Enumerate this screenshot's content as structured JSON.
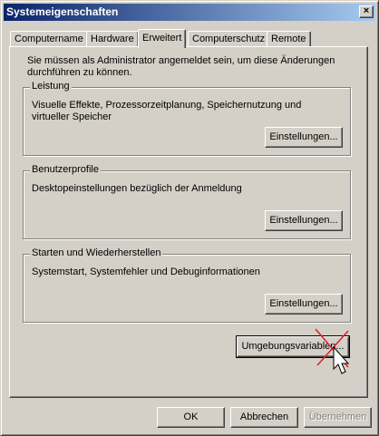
{
  "window": {
    "title": "Systemeigenschaften",
    "close_glyph": "×"
  },
  "tabs": [
    {
      "label": "Computername"
    },
    {
      "label": "Hardware"
    },
    {
      "label": "Erweitert"
    },
    {
      "label": "Computerschutz"
    },
    {
      "label": "Remote"
    }
  ],
  "active_tab": "Erweitert",
  "note": "Sie müssen als Administrator angemeldet sein, um diese Änderungen durchführen zu können.",
  "groups": {
    "performance": {
      "title": "Leistung",
      "text": "Visuelle Effekte, Prozessorzeitplanung, Speichernutzung und virtueller Speicher",
      "button": "Einstellungen..."
    },
    "profiles": {
      "title": "Benutzerprofile",
      "text": "Desktopeinstellungen bezüglich der Anmeldung",
      "button": "Einstellungen..."
    },
    "startup": {
      "title": "Starten und Wiederherstellen",
      "text": "Systemstart, Systemfehler und Debuginformationen",
      "button": "Einstellungen..."
    }
  },
  "env_button": "Umgebungsvariablen...",
  "footer": {
    "ok": "OK",
    "cancel": "Abbrechen",
    "apply": "Übernehmen"
  },
  "colors": {
    "titlebar_start": "#0a246a",
    "titlebar_end": "#a6caf0",
    "face": "#d4d0c8",
    "annotation_x": "#e02020"
  },
  "icons": {
    "cursor": "arrow-pointer-icon",
    "annotation": "red-x-mark"
  }
}
